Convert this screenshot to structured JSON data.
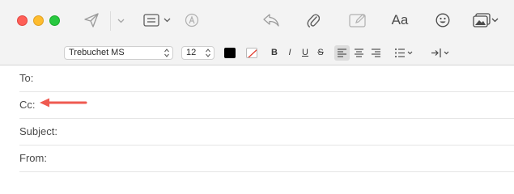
{
  "window": {
    "traffic_lights": [
      "close",
      "minimize",
      "zoom"
    ]
  },
  "toolbar": {
    "icons": {
      "send": "paper-plane-icon",
      "send_menu": "chevron-down-icon",
      "header_fields": "header-fields-icon",
      "markup": "markup-icon",
      "reply": "reply-icon",
      "attach": "paperclip-icon",
      "annotate": "compose-icon",
      "format": "Aa",
      "emoji": "smiley-icon",
      "photo": "photo-browser-icon"
    }
  },
  "format_bar": {
    "font_family": "Trebuchet MS",
    "font_size": "12",
    "text_color": "#000000",
    "bold": "B",
    "italic": "I",
    "underline": "U",
    "strikethrough": "S",
    "alignment_active": "left"
  },
  "fields": {
    "to": "To:",
    "cc": "Cc:",
    "subject": "Subject:",
    "from": "From:"
  },
  "colors": {
    "annotation_arrow": "#ef5a50"
  }
}
